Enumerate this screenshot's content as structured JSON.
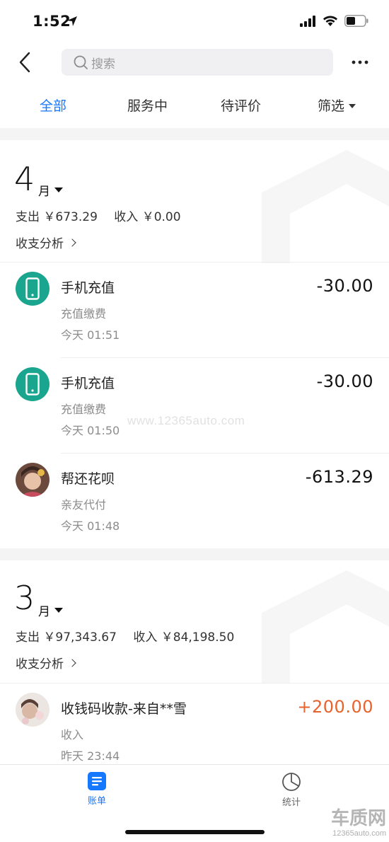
{
  "status_bar": {
    "time": "1:52"
  },
  "search": {
    "placeholder": "搜索"
  },
  "tabs": [
    {
      "label": "全部",
      "active": true
    },
    {
      "label": "服务中"
    },
    {
      "label": "待评价"
    },
    {
      "label": "筛选"
    }
  ],
  "months": [
    {
      "number": "4",
      "unit": "月",
      "expense": "支出 ￥673.29",
      "income": "收入 ￥0.00",
      "analysis": "收支分析",
      "transactions": [
        {
          "title": "手机充值",
          "subtitle": "充值缴费",
          "time": "今天  01:51",
          "amount": "-30.00",
          "icon": "phone-icon"
        },
        {
          "title": "手机充值",
          "subtitle": "充值缴费",
          "time": "今天  01:50",
          "amount": "-30.00",
          "icon": "phone-icon"
        },
        {
          "title": "帮还花呗",
          "subtitle": "亲友代付",
          "time": "今天  01:48",
          "amount": "-613.29",
          "icon": "avatar"
        }
      ]
    },
    {
      "number": "3",
      "unit": "月",
      "expense": "支出 ￥97,343.67",
      "income": "收入 ￥84,198.50",
      "analysis": "收支分析",
      "transactions": [
        {
          "title": "收钱码收款-来自**雪",
          "subtitle": "收入",
          "time": "昨天  23:44",
          "amount": "+200.00",
          "icon": "avatar"
        }
      ]
    }
  ],
  "bottom_nav": [
    {
      "label": "账单",
      "active": true,
      "icon": "bill-icon"
    },
    {
      "label": "统计",
      "icon": "pie-chart-icon"
    }
  ],
  "watermark": "www.12365auto.com",
  "corner_logo": {
    "title": "车质网",
    "url": "12365auto.com"
  },
  "colors": {
    "accent": "#1677ff",
    "income": "#e8632b",
    "icon_bg": "#1aa58e"
  }
}
